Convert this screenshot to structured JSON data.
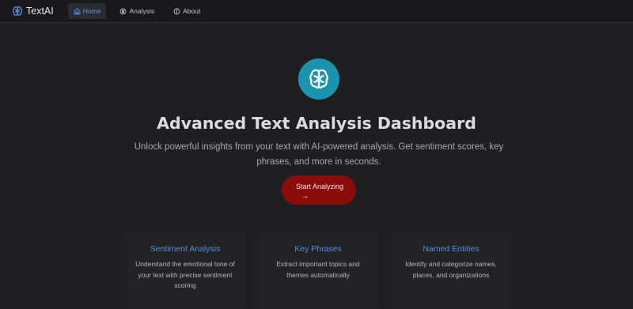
{
  "brand": {
    "name": "TextAI",
    "icon": "brain-icon"
  },
  "nav": {
    "items": [
      {
        "label": "Home",
        "icon": "home-icon",
        "active": true
      },
      {
        "label": "Analysis",
        "icon": "analysis-icon",
        "active": false
      },
      {
        "label": "About",
        "icon": "info-icon",
        "active": false
      }
    ]
  },
  "hero": {
    "icon": "brain-icon",
    "title": "Advanced Text Analysis Dashboard",
    "subtitle": "Unlock powerful insights from your text with AI-powered analysis. Get sentiment scores, key phrases, and more in seconds.",
    "cta_label": "Start Analyzing",
    "cta_icon": "arrow-right-icon"
  },
  "features": [
    {
      "title": "Sentiment Analysis",
      "text": "Understand the emotional tone of your text with precise sentiment scoring"
    },
    {
      "title": "Key Phrases",
      "text": "Extract important topics and themes automatically"
    },
    {
      "title": "Named Entities",
      "text": "Identify and categorize names, places, and organizations"
    }
  ],
  "colors": {
    "background": "#1f1f21",
    "navbar": "#19191b",
    "accent_blue": "#4e8fe0",
    "logo_teal": "#1a93ad",
    "cta_red": "#8a0d0a"
  }
}
